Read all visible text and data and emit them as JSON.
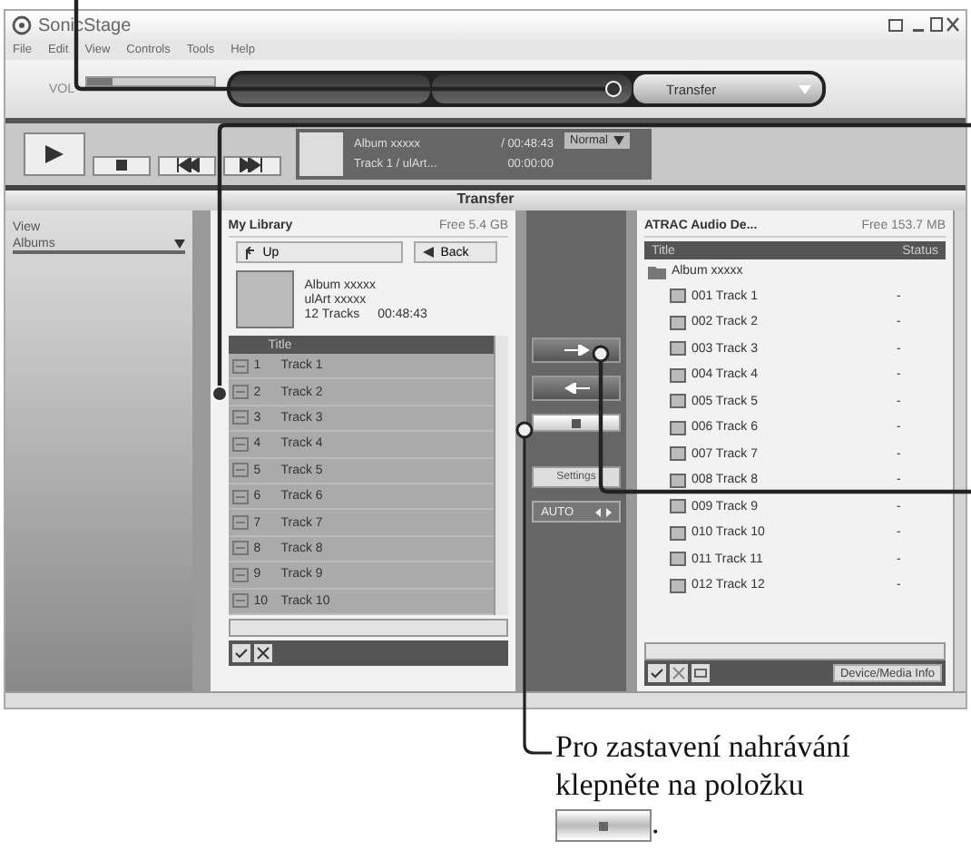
{
  "app": {
    "title": "SonicStage",
    "menu": [
      "File",
      "Edit",
      "View",
      "Controls",
      "Tools",
      "Help"
    ]
  },
  "toolbar": {
    "volume": {
      "label": "VOL",
      "level": 0.2
    },
    "modes": [
      {
        "selected": false
      },
      {
        "selected": false
      },
      {
        "label": "Transfer",
        "selected": true
      }
    ]
  },
  "player": {
    "album": "Album xxxxx",
    "total": "/ 00:48:43",
    "track": "Track 1 / ulArt...",
    "elapsed": "00:00:00",
    "play_mode": "Normal"
  },
  "transfer": {
    "title": "Transfer",
    "view": {
      "label": "View",
      "value": "Albums"
    },
    "library": {
      "title": "My Library",
      "free": "Free 5.4 GB",
      "up": "Up",
      "back": "Back",
      "album": "Album xxxxx",
      "artist": "ulArt xxxxx",
      "tracks_count": "12 Tracks",
      "duration": "00:48:43",
      "column": "Title",
      "rows": [
        {
          "no": "1",
          "title": "Track 1"
        },
        {
          "no": "2",
          "title": "Track 2"
        },
        {
          "no": "3",
          "title": "Track 3"
        },
        {
          "no": "4",
          "title": "Track 4"
        },
        {
          "no": "5",
          "title": "Track 5"
        },
        {
          "no": "6",
          "title": "Track 6"
        },
        {
          "no": "7",
          "title": "Track 7"
        },
        {
          "no": "8",
          "title": "Track 8"
        },
        {
          "no": "9",
          "title": "Track 9"
        },
        {
          "no": "10",
          "title": "Track 10"
        }
      ]
    },
    "settings": "Settings",
    "auto": "AUTO",
    "device": {
      "title": "ATRAC Audio De...",
      "free": "Free 153.7 MB",
      "columns": [
        "Title",
        "Status"
      ],
      "folder": "Album xxxxx",
      "info_button": "Device/Media Info",
      "rows": [
        {
          "title": "001 Track 1",
          "status": "-"
        },
        {
          "title": "002 Track 2",
          "status": "-"
        },
        {
          "title": "003 Track 3",
          "status": "-"
        },
        {
          "title": "004 Track 4",
          "status": "-"
        },
        {
          "title": "005 Track 5",
          "status": "-"
        },
        {
          "title": "006 Track 6",
          "status": "-"
        },
        {
          "title": "007 Track 7",
          "status": "-"
        },
        {
          "title": "008 Track 8",
          "status": "-"
        },
        {
          "title": "009 Track 9",
          "status": "-"
        },
        {
          "title": "010 Track 10",
          "status": "-"
        },
        {
          "title": "011 Track 11",
          "status": "-"
        },
        {
          "title": "012 Track 12",
          "status": "-"
        }
      ]
    }
  },
  "caption": {
    "text": "Pro zastavení nahrávání klepněte na položku",
    "end": "."
  }
}
